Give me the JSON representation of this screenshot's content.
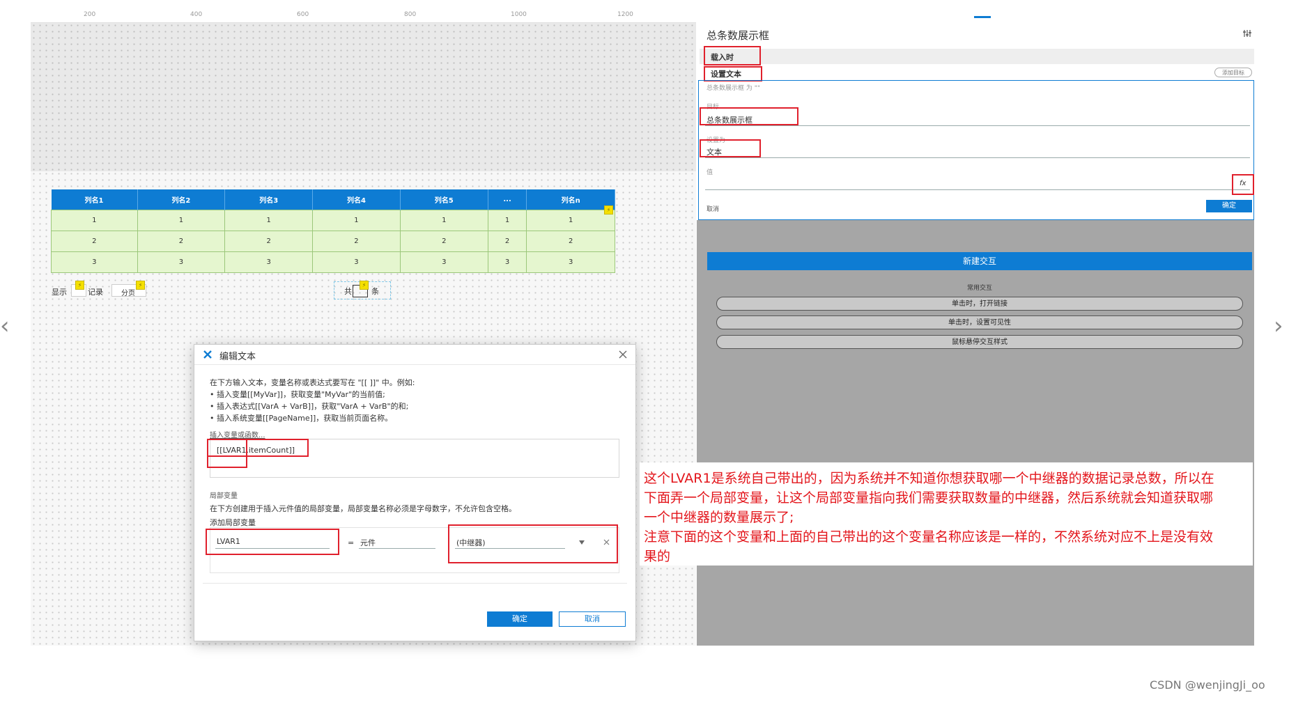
{
  "ruler": {
    "labels": [
      "200",
      "400",
      "600",
      "800",
      "1000",
      "1200"
    ]
  },
  "repeater": {
    "headers": [
      "列名1",
      "列名2",
      "列名3",
      "列名4",
      "列名5",
      "...",
      "列名n"
    ],
    "rows": [
      [
        "1",
        "1",
        "1",
        "1",
        "1",
        "1",
        "1"
      ],
      [
        "2",
        "2",
        "2",
        "2",
        "2",
        "2",
        "2"
      ],
      [
        "3",
        "3",
        "3",
        "3",
        "3",
        "3",
        "3"
      ]
    ]
  },
  "pager": {
    "show_label": "显示",
    "records_label": "记录",
    "page_label": "分页",
    "total_prefix": "共",
    "total_suffix": "条"
  },
  "dialog": {
    "title": "编辑文本",
    "intro": "在下方输入文本，变量名称或表达式要写在 \"[[ ]]\" 中。例如:",
    "example1": "• 插入变量[[MyVar]]，获取变量\"MyVar\"的当前值;",
    "example2": "• 插入表达式[[VarA + VarB]]，获取\"VarA + VarB\"的和;",
    "example3": "• 插入系统变量[[PageName]]，获取当前页面名称。",
    "insert_link": "插入变量或函数...",
    "text_value": "[[LVAR1.itemCount]]",
    "local_section": "局部变量",
    "local_desc": "在下方创建用于插入元件值的局部变量，局部变量名称必须是字母数字，不允许包含空格。",
    "add_local": "添加局部变量",
    "var_name": "LVAR1",
    "equals": "=",
    "var_type": "元件",
    "var_target": "(中继器)",
    "ok": "确定",
    "cancel": "取消"
  },
  "panel": {
    "title": "总条数展示框",
    "event": "载入时",
    "action": "设置文本",
    "add_target": "添加目标",
    "summary": "总条数展示框 为 \"\"",
    "target_label": "目标",
    "target_value": "总条数展示框",
    "set_to_label": "设置为",
    "set_to_value": "文本",
    "value_label": "值",
    "fx": "fx",
    "cancel": "取消",
    "ok": "确定",
    "new_interaction": "新建交互",
    "common_label": "常用交互",
    "common": [
      "单击时，打开链接",
      "单击时，设置可见性",
      "鼠标悬停交互样式"
    ]
  },
  "annotation": {
    "line1": "这个LVAR1是系统自己带出的，因为系统并不知道你想获取哪一个中继器的数据记录总数，所以在",
    "line2": "下面弄一个局部变量，让这个局部变量指向我们需要获取数量的中继器，然后系统就会知道获取哪",
    "line3": "一个中继器的数量展示了;",
    "line4": "注意下面的这个变量和上面的自己带出的这个变量名称应该是一样的，不然系统对应不上是没有效",
    "line5": "果的"
  },
  "watermark": "CSDN @wenjingJi_oo",
  "colors": {
    "accent": "#0e7cd3",
    "highlight": "#e3151b",
    "row_fill": "#e5f6cf"
  },
  "icons": [
    "axure-logo-icon",
    "close-icon",
    "dropdown-icon",
    "fx-icon",
    "chevron-left-icon",
    "chevron-right-icon",
    "lightning-icon"
  ]
}
